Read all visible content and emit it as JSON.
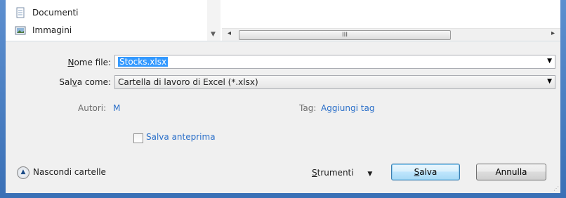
{
  "nav": {
    "items": [
      {
        "label": "Documenti",
        "icon": "documents-folder-icon"
      },
      {
        "label": "Immagini",
        "icon": "pictures-folder-icon"
      }
    ]
  },
  "form": {
    "filename_label_pre": "N",
    "filename_label_rest": "ome file:",
    "filename_value": "Stocks.xlsx",
    "savetype_label_pre": "Sal",
    "savetype_label_mnemonic": "v",
    "savetype_label_rest": "a come:",
    "savetype_value": "Cartella di lavoro di Excel (*.xlsx)"
  },
  "meta": {
    "authors_label": "Autori:",
    "authors_value": "M",
    "tags_label": "Tag:",
    "tags_value": "Aggiungi tag"
  },
  "options": {
    "save_preview_label": "Salva anteprima",
    "save_preview_checked": false
  },
  "footer": {
    "hide_folders_label": "Nascondi cartelle",
    "tools_label_mnemonic": "S",
    "tools_label_rest": "trumenti",
    "save_mnemonic": "S",
    "save_rest": "alva",
    "cancel_label": "Annulla"
  }
}
